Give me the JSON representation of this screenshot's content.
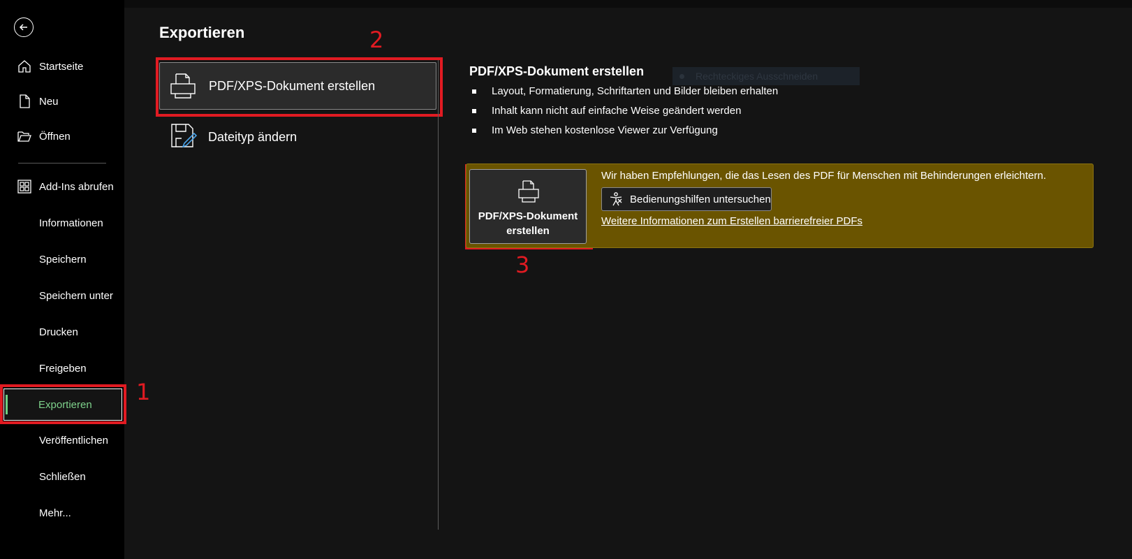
{
  "sidebar": {
    "back_icon": "arrow-left-circle-icon",
    "items": [
      {
        "label": "Startseite",
        "icon": "home-icon"
      },
      {
        "label": "Neu",
        "icon": "new-document-icon"
      },
      {
        "label": "Öffnen",
        "icon": "folder-open-icon"
      },
      {
        "label": "Add-Ins abrufen",
        "icon": "addins-grid-icon"
      },
      {
        "label": "Informationen"
      },
      {
        "label": "Speichern"
      },
      {
        "label": "Speichern unter"
      },
      {
        "label": "Drucken"
      },
      {
        "label": "Freigeben"
      },
      {
        "label": "Exportieren",
        "active": true
      },
      {
        "label": "Veröffentlichen"
      },
      {
        "label": "Schließen"
      },
      {
        "label": "Mehr..."
      }
    ]
  },
  "main": {
    "title": "Exportieren",
    "options": [
      {
        "label": "PDF/XPS-Dokument erstellen",
        "icon": "pdf-printer-icon",
        "selected": true
      },
      {
        "label": "Dateityp ändern",
        "icon": "change-filetype-icon"
      }
    ]
  },
  "detail": {
    "title": "PDF/XPS-Dokument erstellen",
    "ghost_text": "Rechteckiges Ausschneiden",
    "bullets": [
      "Layout, Formatierung, Schriftarten und Bilder bleiben erhalten",
      "Inhalt kann nicht auf einfache Weise geändert werden",
      "Im Web stehen kostenlose Viewer zur Verfügung"
    ],
    "create_button": {
      "line1": "PDF/XPS-Dokument",
      "line2": "erstellen"
    },
    "recommendation": "Wir haben Empfehlungen, die das Lesen des PDF für Menschen mit Behinderungen erleichtern.",
    "accessibility_button": "Bedienungshilfen untersuchen",
    "more_info_link": "Weitere Informationen zum Erstellen barrierefreier PDFs"
  },
  "annotations": [
    "1",
    "2",
    "3"
  ],
  "colors": {
    "annotation": "#e11b22",
    "banner": "#6a5400",
    "active_nav": "#7ed18b",
    "sidebar_bg": "#000000",
    "content_bg": "#141414"
  }
}
